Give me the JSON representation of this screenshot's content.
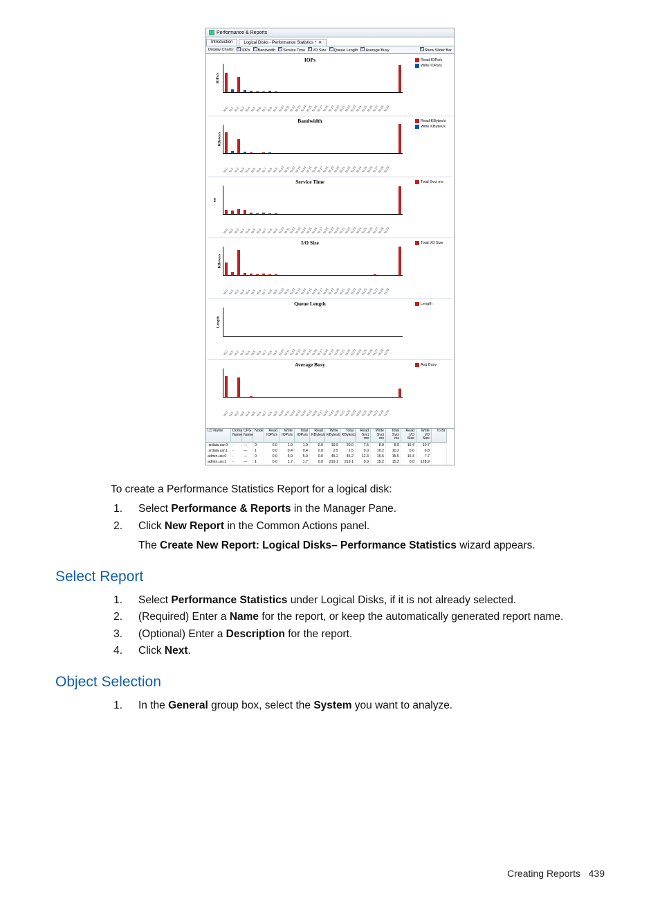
{
  "shot": {
    "window_title": "Performance & Reports",
    "tabs": [
      "Introduction",
      "Logical Disks - Performance Statistics *"
    ],
    "optbar": {
      "leading": "Display Charts:",
      "items": [
        "IOPs",
        "Bandwidth",
        "Service Time",
        "I/O Size",
        "Queue Length",
        "Average Busy"
      ],
      "trailing": "Show Slider Bar"
    },
    "charts": [
      {
        "title": "IOPs",
        "ylabel": "IOPs/s",
        "legend": [
          "Read IOPs/s",
          "Write IOPs/s"
        ]
      },
      {
        "title": "Bandwidth",
        "ylabel": "KBytes/s",
        "legend": [
          "Read KBytes/s",
          "Write KBytes/s"
        ]
      },
      {
        "title": "Service Time",
        "ylabel": "ms",
        "legend": [
          "Total Svct ms"
        ]
      },
      {
        "title": "I/O Size",
        "ylabel": "KBytes/s",
        "legend": [
          "Total I/O Size"
        ]
      },
      {
        "title": "Queue Length",
        "ylabel": "Length",
        "legend": [
          "Length"
        ]
      },
      {
        "title": "Average Busy",
        "ylabel": "",
        "legend": [
          "Avg Busy"
        ]
      }
    ],
    "table": {
      "headers": [
        "LD Name",
        "Domain Name",
        "CPG Name",
        "Node",
        "Read IOPs/s",
        "Write IOPs/s",
        "Total IOPs/s",
        "Read KBytes/s",
        "Write KBytes/s",
        "Total KBytes/s",
        "Read Svct ms",
        "Write Svct ms",
        "Total Svct ms",
        "Read I/O Size",
        "Write I/O Size",
        "To Bi"
      ],
      "rows": [
        [
          ".srdata.usr.0",
          "-",
          "—",
          "0",
          "0.0",
          "1.9",
          "1.9",
          "0.0",
          "19.9",
          "20.0",
          "7.5",
          "8.9",
          "8.9",
          "16.4",
          "10.7",
          ""
        ],
        [
          ".srdata.usr.1",
          "-",
          "—",
          "1",
          "0.0",
          "0.4",
          "0.4",
          "0.0",
          "2.5",
          "2.5",
          "0.0",
          "10.2",
          "10.2",
          "0.0",
          "6.8",
          ""
        ],
        [
          "admin.usr.0",
          "-",
          "—",
          "0",
          "0.0",
          "5.9",
          "5.9",
          "0.0",
          "45.2",
          "45.2",
          "12.3",
          "15.5",
          "15.5",
          "16.4",
          "7.7",
          ""
        ],
        [
          "admin.usr.1",
          "-",
          "—",
          "1",
          "0.0",
          "1.7",
          "1.7",
          "0.0",
          "219.1",
          "219.1",
          "0.0",
          "15.2",
          "15.2",
          "0.0",
          "128.9",
          ""
        ]
      ]
    }
  },
  "chart_data": [
    {
      "type": "bar",
      "title": "IOPs",
      "ylabel": "IOPs/s",
      "series": [
        {
          "name": "Read IOPs/s"
        },
        {
          "name": "Write IOPs/s"
        }
      ],
      "categories_note": "x-axis: logical disk names (rotated labels)",
      "ylim": [
        0,
        10
      ]
    },
    {
      "type": "bar",
      "title": "Bandwidth",
      "ylabel": "KBytes/s",
      "series": [
        {
          "name": "Read KBytes/s"
        },
        {
          "name": "Write KBytes/s"
        }
      ],
      "ylim": [
        0,
        200
      ]
    },
    {
      "type": "bar",
      "title": "Service Time",
      "ylabel": "ms",
      "series": [
        {
          "name": "Total Svct ms"
        }
      ],
      "ylim": [
        0,
        75
      ],
      "ticks": [
        0,
        25,
        50,
        75
      ]
    },
    {
      "type": "bar",
      "title": "I/O Size",
      "ylabel": "KBytes/s",
      "series": [
        {
          "name": "Total I/O Size"
        }
      ],
      "ylim": [
        0,
        200
      ]
    },
    {
      "type": "bar",
      "title": "Queue Length",
      "ylabel": "Length",
      "series": [
        {
          "name": "Length"
        }
      ],
      "ylim": [
        0,
        6
      ]
    },
    {
      "type": "bar",
      "title": "Average Busy",
      "ylabel": "",
      "series": [
        {
          "name": "Avg Busy"
        }
      ],
      "ylim": [
        0,
        2
      ]
    }
  ],
  "body": {
    "intro": "To create a Performance Statistics Report for a logical disk:",
    "s1": "Select ",
    "s1b": "Performance & Reports",
    "s1c": " in the Manager Pane.",
    "s2": "Click ",
    "s2b": "New Report",
    "s2c": " in the Common Actions panel.",
    "s2_post1": "The ",
    "s2_post1b": "Create New Report: Logical Disks– Performance Statistics",
    "s2_post1c": " wizard appears.",
    "h_select": "Select Report",
    "sr1a": "Select ",
    "sr1b": "Performance Statistics",
    "sr1c": " under Logical Disks, if it is not already selected.",
    "sr2a": "(Required) Enter a ",
    "sr2b": "Name",
    "sr2c": " for the report, or keep the automatically generated report name.",
    "sr3a": "(Optional) Enter a ",
    "sr3b": "Description",
    "sr3c": " for the report.",
    "sr4a": "Click ",
    "sr4b": "Next",
    "sr4c": ".",
    "h_obj": "Object Selection",
    "os1a": "In the ",
    "os1b": "General",
    "os1c": " group box, select the ",
    "os1d": "System",
    "os1e": " you want to analyze."
  },
  "footer": {
    "label": "Creating Reports",
    "page": "439"
  }
}
